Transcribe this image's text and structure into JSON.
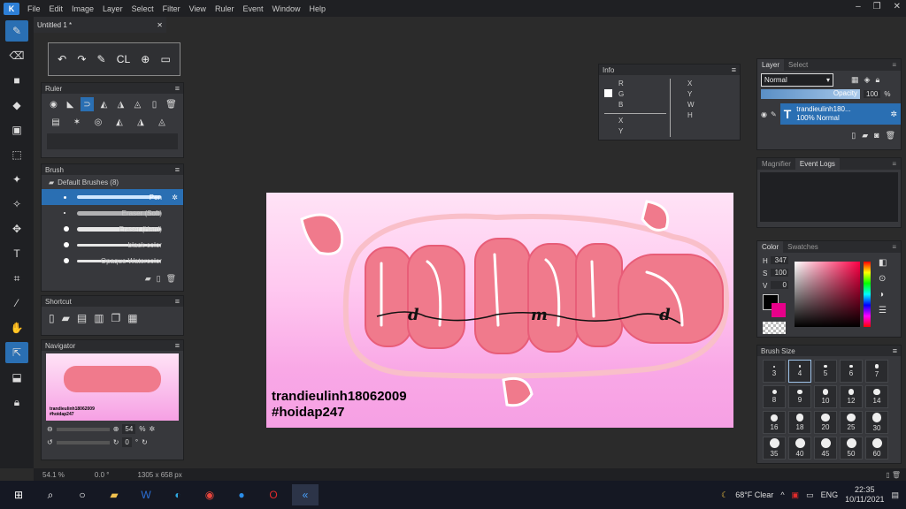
{
  "app": {
    "logo": "K"
  },
  "menu": [
    "File",
    "Edit",
    "Image",
    "Layer",
    "Select",
    "Filter",
    "View",
    "Ruler",
    "Event",
    "Window",
    "Help"
  ],
  "window_controls": [
    "–",
    "❐",
    "✕"
  ],
  "document": {
    "tab_title": "Untitled 1 *",
    "close": "✕"
  },
  "quick_tools": {
    "undo": "↶",
    "redo": "↷",
    "pen": "✎",
    "cl": "CL",
    "target": "⊕",
    "window": "▭"
  },
  "ruler": {
    "title": "Ruler"
  },
  "brush": {
    "title": "Brush",
    "group": "Default Brushes (8)",
    "items": [
      {
        "label": "Pen",
        "selected": true
      },
      {
        "label": "Eraser (Soft)"
      },
      {
        "label": "Eraser (Hard)"
      },
      {
        "label": "black color"
      },
      {
        "label": "Opaque Watercolor"
      }
    ]
  },
  "shortcut": {
    "title": "Shortcut"
  },
  "navigator": {
    "title": "Navigator",
    "zoom": "54",
    "zoom_unit": "%",
    "rotate": "0",
    "rotate_unit": "°",
    "thumb_line1": "trandieulinh18062009",
    "thumb_line2": "#hoidap247"
  },
  "info": {
    "title": "Info",
    "r": "R",
    "g": "G",
    "b": "B",
    "x1": "X",
    "y1": "Y",
    "x2": "X",
    "y2": "Y",
    "w": "W",
    "h": "H"
  },
  "layer": {
    "tab_layer": "Layer",
    "tab_select": "Select",
    "blend": "Normal",
    "opacity_label": "Opacity",
    "opacity_value": "100",
    "opacity_unit": "%",
    "layer_name": "trandieulinh180...",
    "layer_mode": "100% Normal",
    "layer_type": "T"
  },
  "events": {
    "tab_magnifier": "Magnifier",
    "tab_event_logs": "Event Logs"
  },
  "color": {
    "tab_color": "Color",
    "tab_swatches": "Swatches",
    "h_label": "H",
    "h": "347",
    "s_label": "S",
    "s": "100",
    "v_label": "V",
    "v": "0",
    "fg": "#000000",
    "bg": "#e8008a"
  },
  "brush_size": {
    "title": "Brush Size",
    "sizes": [
      "3",
      "4",
      "5",
      "6",
      "7",
      "8",
      "9",
      "10",
      "12",
      "14",
      "16",
      "18",
      "20",
      "25",
      "30",
      "35",
      "40",
      "45",
      "50",
      "60"
    ],
    "selected": "4"
  },
  "canvas_text": {
    "line1": "trandieulinh18062009",
    "line2": "#hoidap247",
    "dmd": "d   m   d"
  },
  "status": {
    "zoom": "54.1 %",
    "angle": "0.0 °",
    "size": "1305 x 658 px"
  },
  "taskbar": {
    "weather": "68°F  Clear",
    "lang": "ENG",
    "time": "22:35",
    "date": "10/11/2021"
  },
  "colors": {
    "accent": "#2a6fb3",
    "pink": "#f07a8c",
    "dark_pink": "#e85d78"
  }
}
